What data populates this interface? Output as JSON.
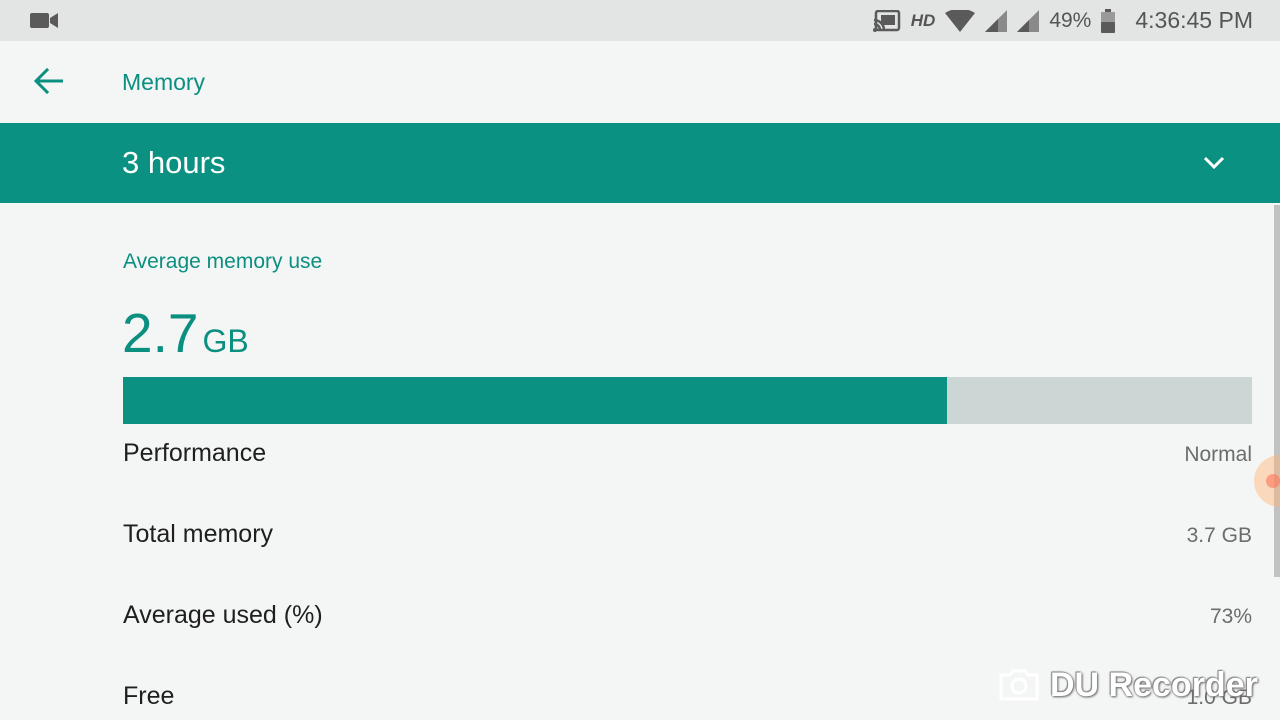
{
  "status_bar": {
    "hd": "HD",
    "battery": "49%",
    "time": "4:36:45 PM"
  },
  "app_bar": {
    "title": "Memory"
  },
  "period": {
    "selected": "3 hours"
  },
  "summary": {
    "section_title": "Average memory use",
    "value": "2.7",
    "unit": "GB",
    "usage_fraction": 0.73
  },
  "rows": [
    {
      "label": "Performance",
      "value": "Normal"
    },
    {
      "label": "Total memory",
      "value": "3.7 GB"
    },
    {
      "label": "Average used (%)",
      "value": "73%"
    },
    {
      "label": "Free",
      "value": "1.0 GB"
    }
  ],
  "watermark": {
    "text": "DU Recorder"
  },
  "colors": {
    "accent": "#0a9181",
    "bar_track": "#ccd7d5"
  }
}
